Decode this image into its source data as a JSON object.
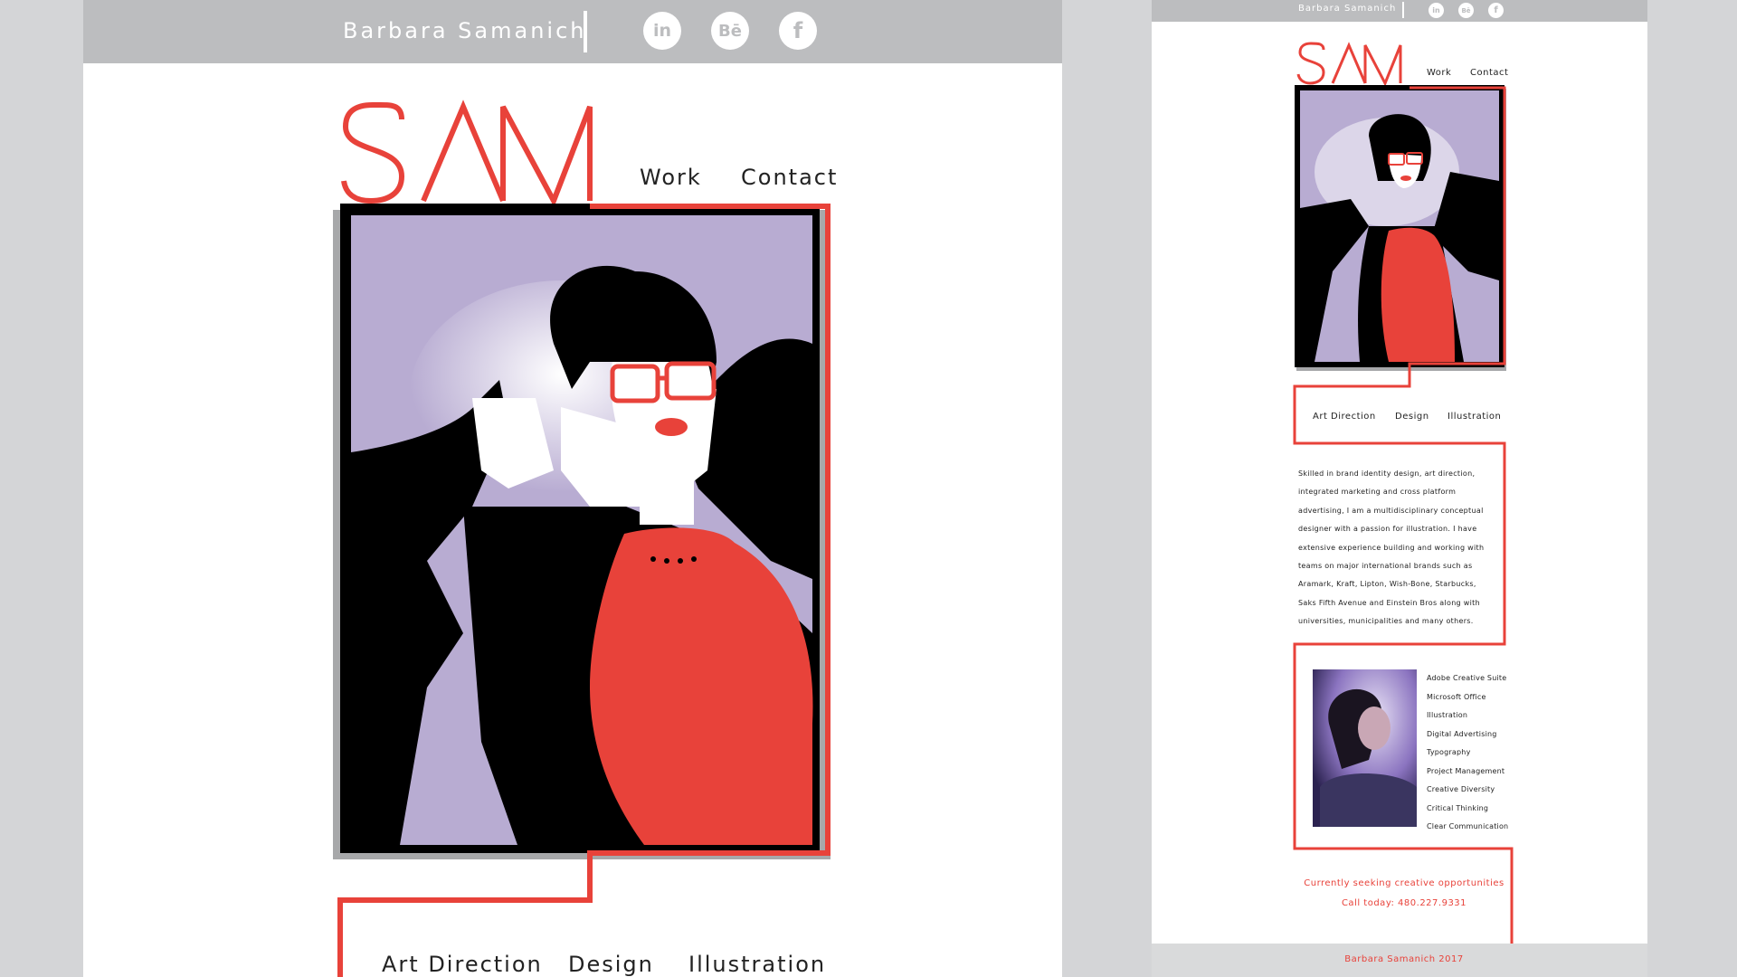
{
  "colors": {
    "accent_red": "#e8423a",
    "bar_gray": "#bcbdbf",
    "page_bg": "#d4d5d7",
    "illustration_purple": "#b8acd2"
  },
  "desktop": {
    "header": {
      "brand_name": "Barbara Samanich",
      "social": [
        {
          "name": "linkedin-icon",
          "glyph": "in"
        },
        {
          "name": "behance-icon",
          "glyph": "Bē"
        },
        {
          "name": "facebook-icon",
          "glyph": "f"
        }
      ]
    },
    "logo": "SAM",
    "nav": {
      "work": "Work",
      "contact": "Contact"
    },
    "services": [
      "Art Direction",
      "Design",
      "Illustration"
    ]
  },
  "mobile": {
    "header": {
      "brand_name": "Barbara Samanich",
      "social": [
        {
          "name": "linkedin-icon",
          "glyph": "in"
        },
        {
          "name": "behance-icon",
          "glyph": "Bē"
        },
        {
          "name": "facebook-icon",
          "glyph": "f"
        }
      ]
    },
    "logo": "SAM",
    "nav": {
      "work": "Work",
      "contact": "Contact"
    },
    "services": [
      "Art Direction",
      "Design",
      "Illustration"
    ],
    "bio_lines": [
      "Skilled in brand identity design, art direction,",
      "integrated marketing and cross platform",
      "advertising, I am a multidisciplinary conceptual",
      "designer with a passion for illustration. I have",
      "extensive experience building and working with",
      "teams on major international brands such as",
      "Aramark, Kraft, Lipton, Wish-Bone, Starbucks,",
      "Saks Fifth Avenue and Einstein Bros along with",
      "universities, municipalities and many others."
    ],
    "skills": [
      "Adobe Creative Suite",
      "Microsoft Office",
      "Illustration",
      "Digital Advertising",
      "Typography",
      "Project Management",
      "Creative Diversity",
      "Critical Thinking",
      "Clear Communication"
    ],
    "seeking": "Currently seeking creative opportunities",
    "phone": "Call today: 480.227.9331",
    "footer": "Barbara Samanich 2017"
  }
}
